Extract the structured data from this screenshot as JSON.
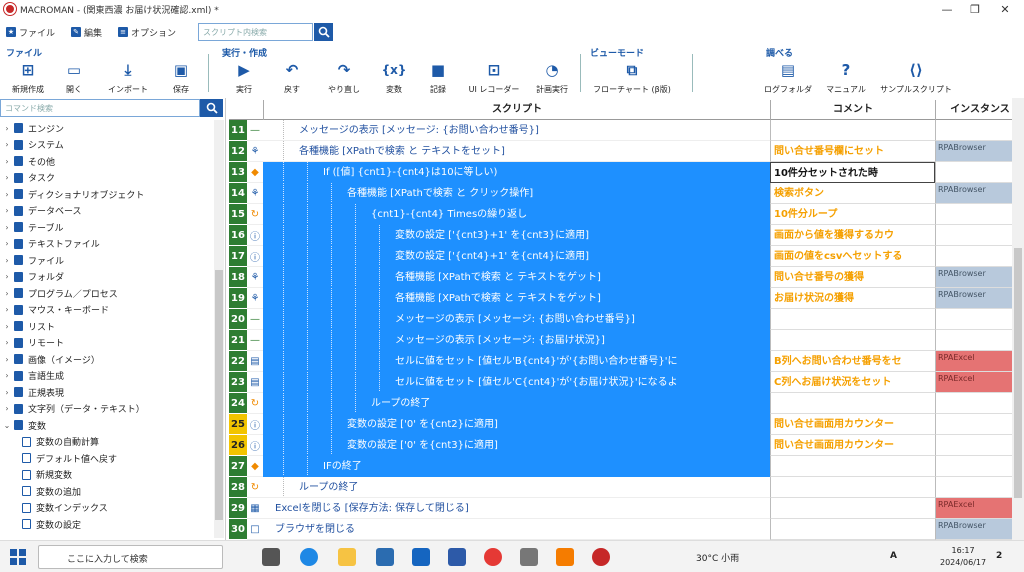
{
  "window": {
    "title": "MACROMAN - (関東西濃 お届け状況確認.xml) *"
  },
  "menu": {
    "file": "ファイル",
    "edit": "編集",
    "options": "オプション",
    "search_placeholder": "スクリプト内検索"
  },
  "ribbon": {
    "groups": {
      "file": "ファイル",
      "run": "実行・作成",
      "view": "ビューモード",
      "lookup": "調べる"
    },
    "buttons": {
      "new": "新規作成",
      "open": "開く",
      "import": "インポート",
      "save": "保存",
      "run": "実行",
      "undo": "戻す",
      "redo": "やり直し",
      "variable": "変数",
      "record": "記録",
      "ui_recorder": "UI レコーダー",
      "scheduled": "計画実行",
      "flowchart": "フローチャート (β版)",
      "log_folder": "ログフォルダ",
      "manual": "マニュアル",
      "sample_script": "サンプルスクリプト"
    }
  },
  "left_panel": {
    "search_placeholder": "コマンド検索",
    "items": [
      "エンジン",
      "システム",
      "その他",
      "タスク",
      "ディクショナリオブジェクト",
      "データベース",
      "テーブル",
      "テキストファイル",
      "ファイル",
      "フォルダ",
      "プログラム／プロセス",
      "マウス・キーボード",
      "リスト",
      "リモート",
      "画像（イメージ）",
      "言語生成",
      "正規表現",
      "文字列（データ・テキスト）",
      "変数"
    ],
    "children": [
      "変数の自動計算",
      "デフォルト値へ戻す",
      "新規変数",
      "変数の追加",
      "変数インデックス",
      "変数の設定"
    ]
  },
  "grid": {
    "headers": {
      "script": "スクリプト",
      "comment": "コメント",
      "instance": "インスタンス"
    },
    "rows": [
      {
        "n": "11",
        "code": "メッセージの表示 [メッセージ: {お問い合わせ番号}]",
        "comment": "",
        "inst": ""
      },
      {
        "n": "12",
        "code": "各種機能 [XPathで検索 と テキストをセット]",
        "comment": "問い合せ番号欄にセット",
        "inst": "RPABrowser"
      },
      {
        "n": "13",
        "code": "If ([値] {cnt1}-{cnt4}は10に等しい)",
        "comment": "10件分セットされた時",
        "inst": ""
      },
      {
        "n": "14",
        "code": "各種機能 [XPathで検索 と クリック操作]",
        "comment": "検索ボタン",
        "inst": "RPABrowser"
      },
      {
        "n": "15",
        "code": "{cnt1}-{cnt4} Timesの繰り返し",
        "comment": "10件分ループ",
        "inst": ""
      },
      {
        "n": "16",
        "code": "変数の設定 ['{cnt3}+1' を{cnt3}に適用]",
        "comment": "画面から値を獲得するカウ",
        "inst": ""
      },
      {
        "n": "17",
        "code": "変数の設定 ['{cnt4}+1' を{cnt4}に適用]",
        "comment": "画面の値をcsvへセットする",
        "inst": ""
      },
      {
        "n": "18",
        "code": "各種機能 [XPathで検索 と テキストをゲット]",
        "comment": "問い合せ番号の獲得",
        "inst": "RPABrowser"
      },
      {
        "n": "19",
        "code": "各種機能 [XPathで検索 と テキストをゲット]",
        "comment": "お届け状況の獲得",
        "inst": "RPABrowser"
      },
      {
        "n": "20",
        "code": "メッセージの表示 [メッセージ: {お問い合わせ番号}]",
        "comment": "",
        "inst": ""
      },
      {
        "n": "21",
        "code": "メッセージの表示 [メッセージ: {お届け状況}]",
        "comment": "",
        "inst": ""
      },
      {
        "n": "22",
        "code": "セルに値をセット [値セル'B{cnt4}'が'{お問い合わせ番号}'に",
        "comment": "B列へお問い合わせ番号をセ",
        "inst": "RPAExcel"
      },
      {
        "n": "23",
        "code": "セルに値をセット [値セル'C{cnt4}'が'{お届け状況}'になるよ",
        "comment": "C列へお届け状況をセット",
        "inst": "RPAExcel"
      },
      {
        "n": "24",
        "code": "ループの終了",
        "comment": "",
        "inst": ""
      },
      {
        "n": "25",
        "code": "変数の設定 ['0' を{cnt2}に適用]",
        "comment": "問い合せ画面用カウンター",
        "inst": ""
      },
      {
        "n": "26",
        "code": "変数の設定 ['0' を{cnt3}に適用]",
        "comment": "問い合せ画面用カウンター",
        "inst": ""
      },
      {
        "n": "27",
        "code": "IFの終了",
        "comment": "",
        "inst": ""
      },
      {
        "n": "28",
        "code": "ループの終了",
        "comment": "",
        "inst": ""
      },
      {
        "n": "29",
        "code": "Excelを閉じる [保存方法: 保存して閉じる]",
        "comment": "",
        "inst": "RPAExcel"
      },
      {
        "n": "30",
        "code": "ブラウザを閉じる",
        "comment": "",
        "inst": "RPABrowser"
      }
    ]
  },
  "taskbar": {
    "search": "ここに入力して検索",
    "weather": "30°C 小雨",
    "ime": "A",
    "time": "16:17",
    "date": "2024/06/17",
    "notifications": "2"
  },
  "colors": {
    "accent": "#1e5aa8",
    "selection": "#1e90ff",
    "line_green": "#2e7d32",
    "comment_orange": "#f5a000"
  }
}
